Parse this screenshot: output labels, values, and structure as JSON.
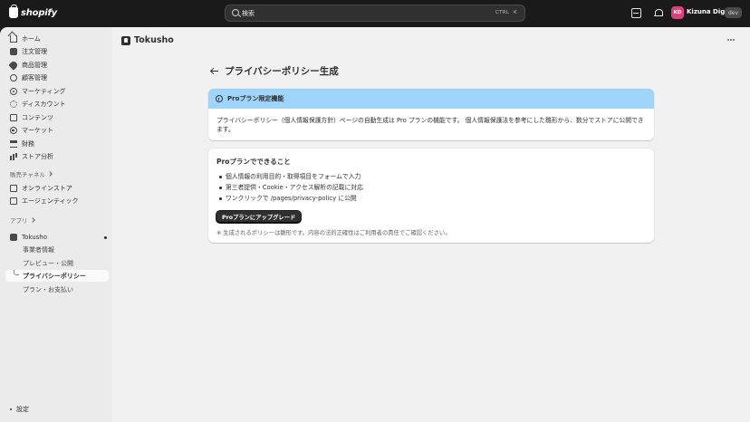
{
  "topbar": {
    "logo_text": "shopify",
    "search_placeholder": "検索",
    "shortcut_ctrl": "CTRL",
    "shortcut_key": "K",
    "avatar_initials": "KD",
    "store_name": "Kizuna Digital",
    "store_badge": "dev"
  },
  "sidebar": {
    "items": [
      {
        "label": "ホーム",
        "icon": "home-icon"
      },
      {
        "label": "注文管理",
        "icon": "inbox-icon"
      },
      {
        "label": "商品管理",
        "icon": "tag-icon"
      },
      {
        "label": "顧客管理",
        "icon": "person-icon"
      },
      {
        "label": "マーケティング",
        "icon": "target-icon"
      },
      {
        "label": "ディスカウント",
        "icon": "discount-icon"
      },
      {
        "label": "コンテンツ",
        "icon": "content-icon"
      },
      {
        "label": "マーケット",
        "icon": "globe-icon"
      },
      {
        "label": "財務",
        "icon": "bank-icon"
      },
      {
        "label": "ストア分析",
        "icon": "analytics-icon"
      }
    ],
    "sales_channels_label": "販売チャネル",
    "channels": [
      {
        "label": "オンラインストア",
        "icon": "store-icon"
      },
      {
        "label": "エージェンティック",
        "icon": "agentic-icon"
      }
    ],
    "apps_label": "アプリ",
    "app": {
      "label": "Tokusho"
    },
    "app_pages": [
      {
        "label": "事業者情報",
        "active": false
      },
      {
        "label": "プレビュー・公開",
        "active": false
      },
      {
        "label": "プライバシーポリシー",
        "active": true
      },
      {
        "label": "プラン・お支払い",
        "active": false
      }
    ],
    "settings_label": "設定"
  },
  "main": {
    "app_name": "Tokusho",
    "page_title": "プライバシーポリシー生成",
    "banner": {
      "title": "Proプラン限定機能",
      "body": "プライバシーポリシー（個人情報保護方針）ページの自動生成は Pro プランの機能です。 個人情報保護法を参考にした雛形から、数分でストアに公開できます。"
    },
    "card": {
      "title": "Proプランでできること",
      "features": [
        "個人情報の利用目的・取得項目をフォームで入力",
        "第三者提供・Cookie・アクセス解析の記載に対応",
        "ワンクリックで /pages/privacy-policy に公開"
      ],
      "upgrade_label": "Proプランにアップグレード",
      "note": "※ 生成されるポリシーは雛形です。内容の法的正確性はご利用者の責任でご確認ください。"
    }
  },
  "colors": {
    "banner_header": "#9fd4fb",
    "avatar": "#e0407a",
    "topbar": "#1a1a1a"
  }
}
